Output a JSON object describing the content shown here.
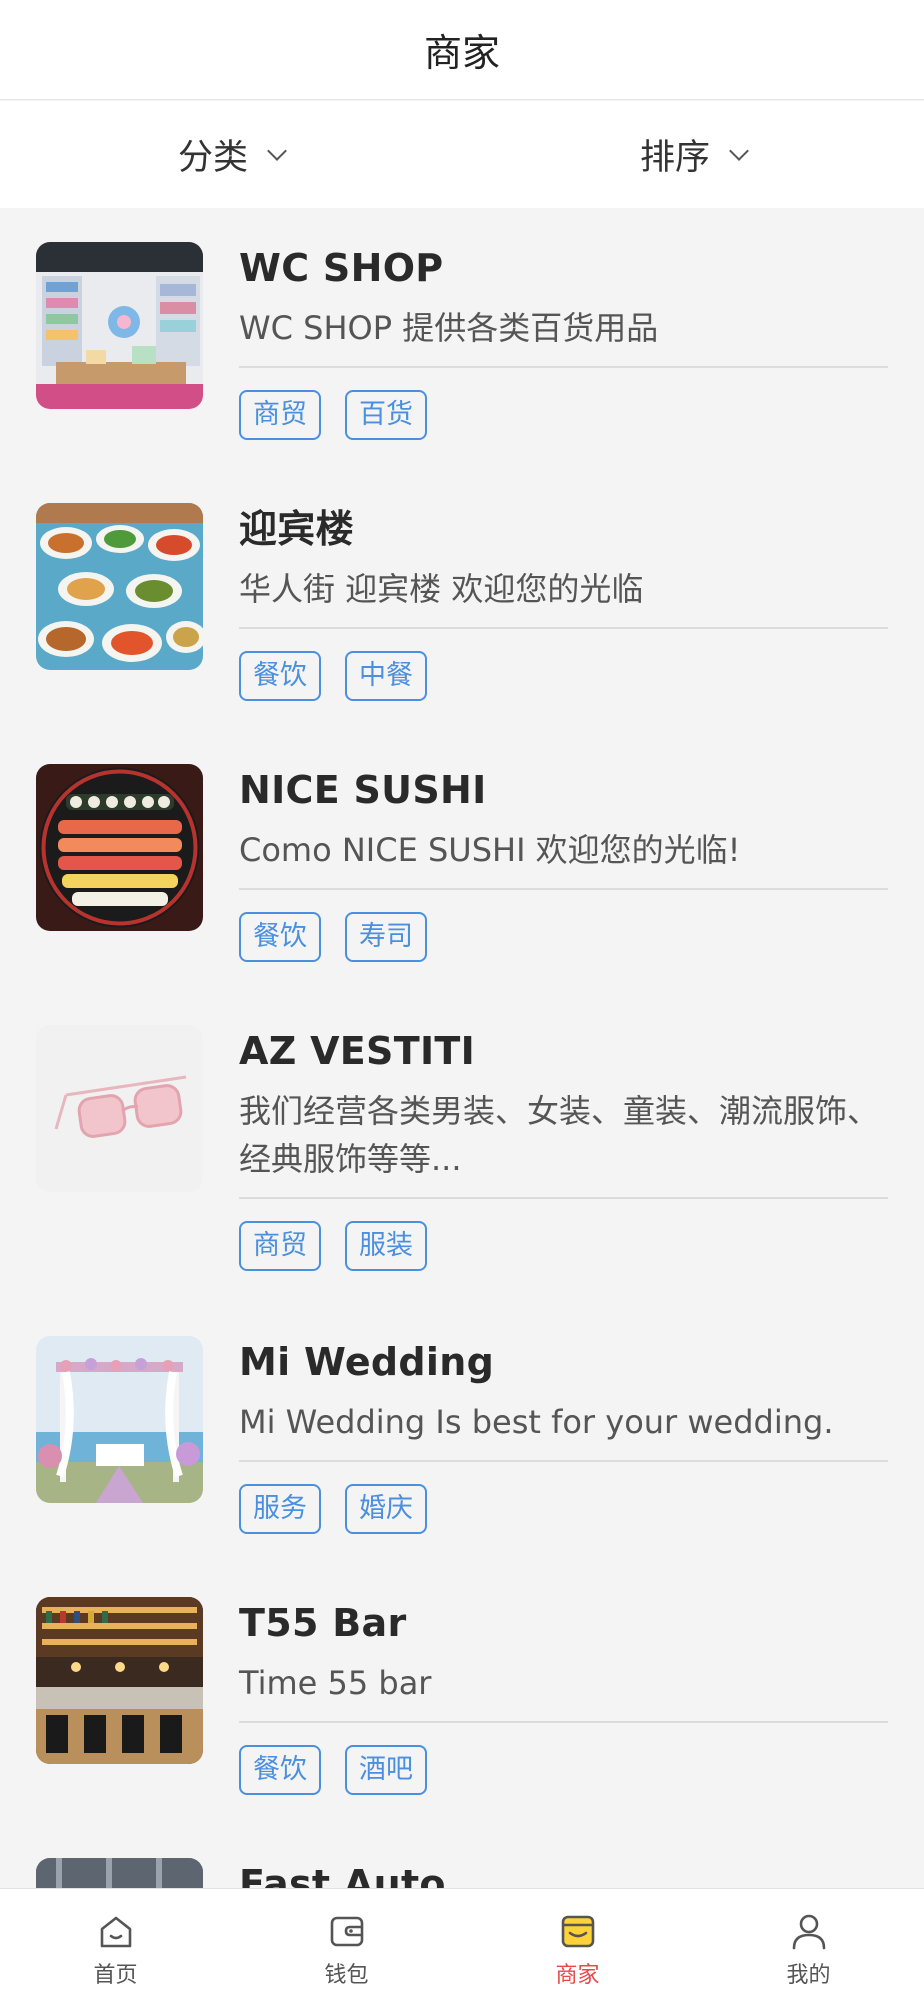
{
  "header": {
    "title": "商家"
  },
  "filters": {
    "category": "分类",
    "sort": "排序"
  },
  "merchants": [
    {
      "name": "WC SHOP",
      "desc": "WC SHOP 提供各类百货用品",
      "tags": [
        "商贸",
        "百货"
      ],
      "image": "retail-store-photo"
    },
    {
      "name": "迎宾楼",
      "desc": "华人街 迎宾楼 欢迎您的光临",
      "tags": [
        "餐饮",
        "中餐"
      ],
      "image": "chinese-dishes-photo"
    },
    {
      "name": "NICE SUSHI",
      "desc": "Como NICE SUSHI 欢迎您的光临!",
      "tags": [
        "餐饮",
        "寿司"
      ],
      "image": "sushi-platter-photo"
    },
    {
      "name": "AZ VESTITI",
      "desc": "我们经营各类男装、女装、童装、潮流服饰、经典服饰等等...",
      "tags": [
        "商贸",
        "服装"
      ],
      "image": "sunglasses-photo"
    },
    {
      "name": "Mi Wedding",
      "desc": "Mi Wedding Is best for your wedding.",
      "tags": [
        "服务",
        "婚庆"
      ],
      "image": "wedding-arch-photo"
    },
    {
      "name": "T55 Bar",
      "desc": "Time 55 bar",
      "tags": [
        "餐饮",
        "酒吧"
      ],
      "image": "bar-interior-photo"
    },
    {
      "name": "Fast Auto",
      "desc": "",
      "tags": [],
      "image": "auto-shop-photo"
    }
  ],
  "tabbar": {
    "items": [
      {
        "label": "首页",
        "icon": "home-icon"
      },
      {
        "label": "钱包",
        "icon": "wallet-icon"
      },
      {
        "label": "商家",
        "icon": "shop-icon"
      },
      {
        "label": "我的",
        "icon": "user-icon"
      }
    ],
    "active": "商家"
  },
  "colors": {
    "accent": "#4a8fe0",
    "active_tab": "#e94848",
    "background": "#f4f4f4"
  }
}
